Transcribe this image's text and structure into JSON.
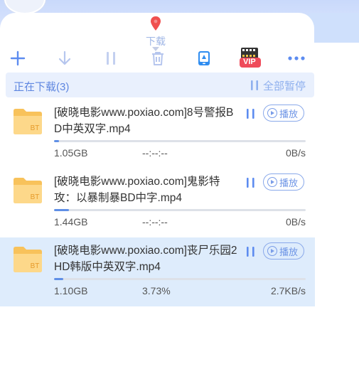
{
  "window": {
    "accent_color": "#5e86e0",
    "bg_top": "#c9d9fb"
  },
  "tab": {
    "label": "下载",
    "icon": "map-pin-icon"
  },
  "toolbar": {
    "buttons": [
      {
        "name": "add-icon"
      },
      {
        "name": "download-arrow-icon"
      },
      {
        "name": "pause-icon"
      },
      {
        "name": "trash-icon"
      },
      {
        "name": "phone-app-icon"
      },
      {
        "name": "vip-film-icon",
        "label": "VIP"
      },
      {
        "name": "more-icon"
      }
    ]
  },
  "header": {
    "title": "正在下载(3)",
    "pause_all": "全部暂停"
  },
  "downloads": [
    {
      "name": "[破晓电影www.poxiao.com]8号警报BD中英双字.mp4",
      "folder_tag": "BT",
      "play_label": "播放",
      "size": "1.05GB",
      "percent": "--:--:--",
      "speed": "0B/s",
      "progress": 0.02
    },
    {
      "name": "[破晓电影www.poxiao.com]鬼影特攻：以暴制暴BD中字.mp4",
      "folder_tag": "BT",
      "play_label": "播放",
      "size": "1.44GB",
      "percent": "--:--:--",
      "speed": "0B/s",
      "progress": 0.06
    },
    {
      "name": "[破晓电影www.poxiao.com]丧尸乐园2HD韩版中英双字.mp4",
      "folder_tag": "BT",
      "play_label": "播放",
      "size": "1.10GB",
      "percent": "3.73%",
      "speed": "2.7KB/s",
      "progress": 0.0373
    }
  ]
}
